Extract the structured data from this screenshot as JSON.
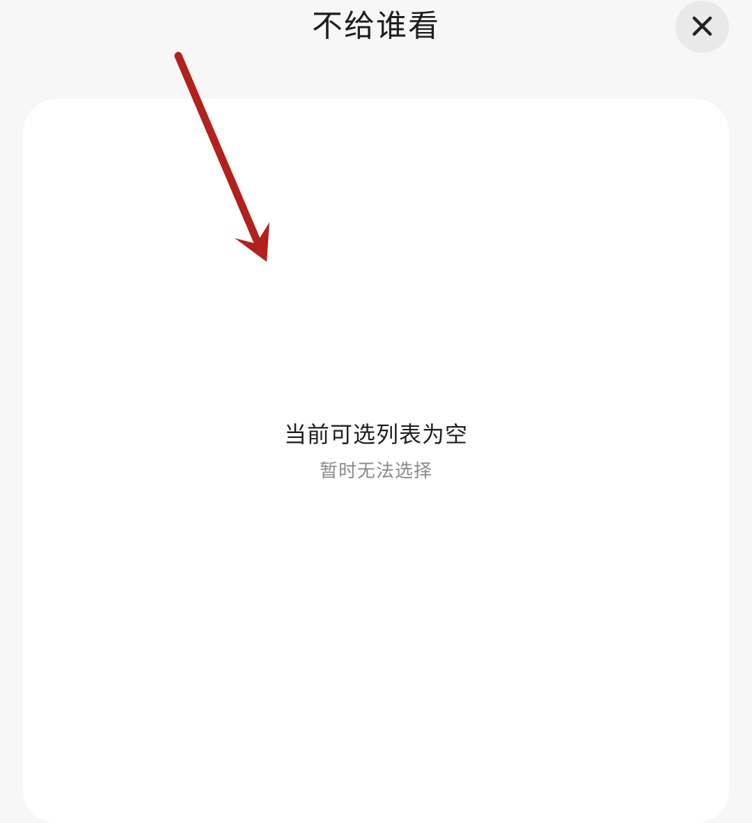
{
  "header": {
    "title": "不给谁看",
    "close_icon": "close-icon"
  },
  "empty_state": {
    "title": "当前可选列表为空",
    "subtitle": "暂时无法选择"
  },
  "annotation": {
    "icon": "red-arrow-annotation",
    "color": "#b3211c"
  },
  "colors": {
    "background": "#f7f7f7",
    "panel": "#ffffff",
    "primary_text": "#1f1f1f",
    "secondary_text": "#8a8a8a",
    "close_button_bg": "#e9e9e9"
  }
}
